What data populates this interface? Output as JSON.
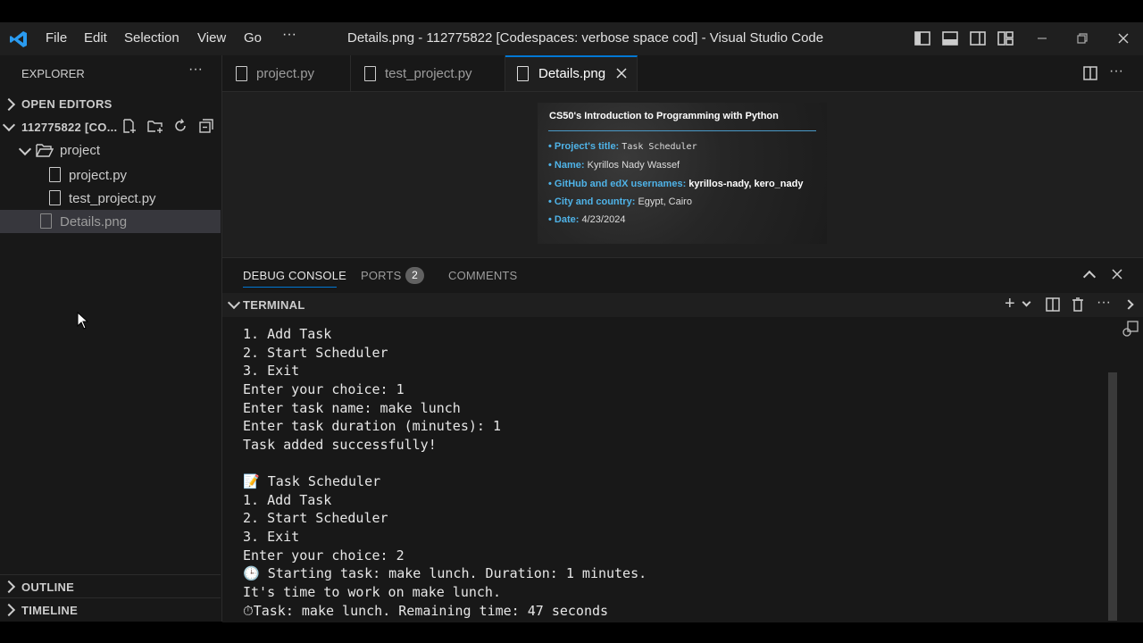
{
  "window": {
    "title": "Details.png - 112775822 [Codespaces: verbose space cod] - Visual Studio Code",
    "menu": [
      "File",
      "Edit",
      "Selection",
      "View",
      "Go"
    ],
    "more": "···"
  },
  "sidebar": {
    "header": "EXPLORER",
    "open_editors": "OPEN EDITORS",
    "root": "112775822 [CO...",
    "folder": "project",
    "files": [
      "project.py",
      "test_project.py"
    ],
    "selected_file": "Details.png",
    "outline": "OUTLINE",
    "timeline": "TIMELINE"
  },
  "tabs": [
    {
      "label": "project.py",
      "active": false
    },
    {
      "label": "test_project.py",
      "active": false
    },
    {
      "label": "Details.png",
      "active": true
    }
  ],
  "preview": {
    "heading": "CS50's Introduction to Programming with Python",
    "rows": [
      {
        "key": "Project's title:",
        "value": "Task Scheduler"
      },
      {
        "key": "Name:",
        "value": "Kyrillos Nady Wassef"
      },
      {
        "key": "GitHub and edX usernames:",
        "value": "kyrillos-nady, kero_nady"
      },
      {
        "key": "City and country:",
        "value": "Egypt, Cairo"
      },
      {
        "key": "Date:",
        "value": "4/23/2024"
      }
    ]
  },
  "panel": {
    "tabs": [
      "DEBUG CONSOLE",
      "PORTS",
      "COMMENTS"
    ],
    "ports_badge": "2",
    "terminal_title": "TERMINAL",
    "lines": [
      "1. Add Task",
      "2. Start Scheduler",
      "3. Exit",
      "Enter your choice: 1",
      "Enter task name: make lunch",
      "Enter task duration (minutes): 1",
      "Task added successfully!",
      "",
      "📝 Task Scheduler",
      "1. Add Task",
      "2. Start Scheduler",
      "3. Exit",
      "Enter your choice: 2",
      "🕒 Starting task: make lunch. Duration: 1 minutes.",
      "It's time to work on make lunch.",
      "⏱Task: make lunch. Remaining time: 47 seconds"
    ]
  },
  "colors": {
    "accent": "#0078d4",
    "preview_key": "#4fb3e8"
  }
}
